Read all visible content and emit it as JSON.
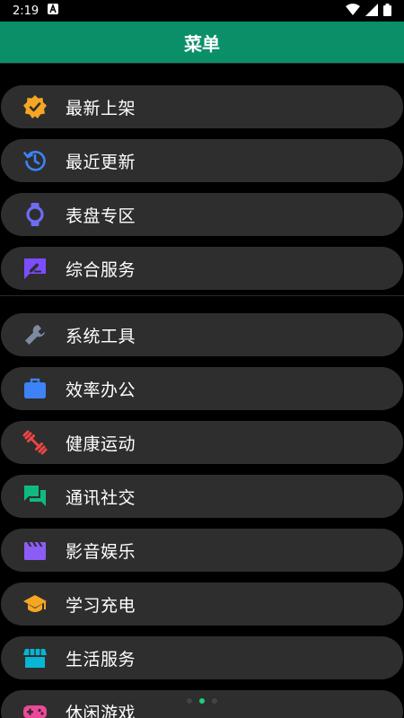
{
  "status": {
    "time": "2:19"
  },
  "appbar": {
    "title": "菜单"
  },
  "menu_groups": [
    [
      {
        "label": "最新上架",
        "icon": "verified-badge-icon",
        "color": "#f5a623"
      },
      {
        "label": "最近更新",
        "icon": "history-icon",
        "color": "#3d82f6"
      },
      {
        "label": "表盘专区",
        "icon": "watch-icon",
        "color": "#6f6cf3"
      },
      {
        "label": "综合服务",
        "icon": "edit-chat-icon",
        "color": "#7c4dff"
      }
    ],
    [
      {
        "label": "系统工具",
        "icon": "wrench-icon",
        "color": "#7d8aa0"
      },
      {
        "label": "效率办公",
        "icon": "briefcase-icon",
        "color": "#3d82f6"
      },
      {
        "label": "健康运动",
        "icon": "dumbbell-icon",
        "color": "#ef4444"
      },
      {
        "label": "通讯社交",
        "icon": "chat-icon",
        "color": "#10b981"
      },
      {
        "label": "影音娱乐",
        "icon": "clapperboard-icon",
        "color": "#8b5cf6"
      },
      {
        "label": "学习充电",
        "icon": "graduation-cap-icon",
        "color": "#f5a623"
      },
      {
        "label": "生活服务",
        "icon": "store-icon",
        "color": "#06b6d4"
      },
      {
        "label": "休闲游戏",
        "icon": "gamepad-icon",
        "color": "#ec4899"
      }
    ]
  ],
  "pager": {
    "active_index": 1
  }
}
